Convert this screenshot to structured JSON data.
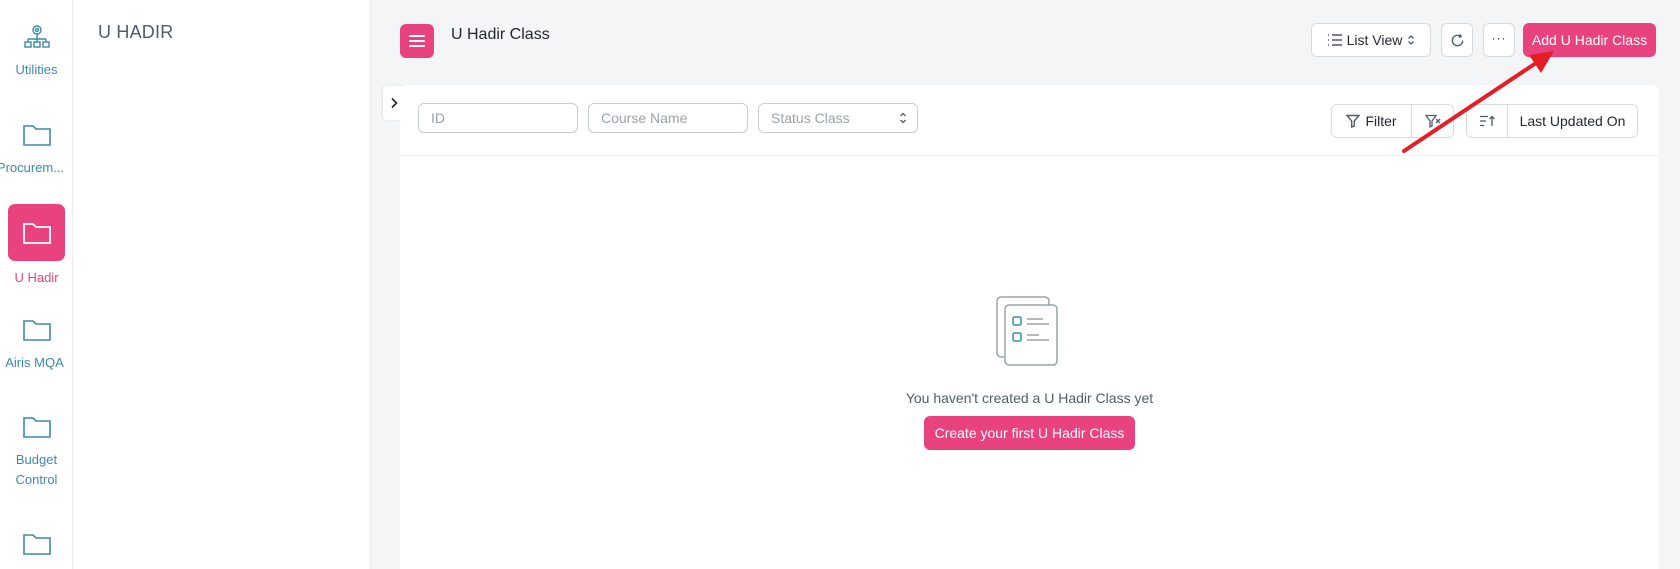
{
  "rail": {
    "items": [
      {
        "label": "Utilities",
        "icon": "org-chart-icon"
      },
      {
        "label": "Procurem...",
        "icon": "folder-icon"
      },
      {
        "label": "U Hadir",
        "icon": "folder-icon",
        "active": true
      },
      {
        "label": "Airis MQA",
        "icon": "folder-icon"
      },
      {
        "label": "Budget Control",
        "icon": "folder-icon"
      },
      {
        "label": "",
        "icon": "folder-icon"
      }
    ]
  },
  "workspace": {
    "title": "U HADIR"
  },
  "header": {
    "title": "U Hadir Class",
    "view_select": "List View",
    "add_button": "Add U Hadir Class",
    "more_label": "···"
  },
  "filters": {
    "id_placeholder": "ID",
    "course_placeholder": "Course Name",
    "status_placeholder": "Status Class",
    "filter_label": "Filter",
    "sort_label": "Last Updated On"
  },
  "empty_state": {
    "message": "You haven't created a U Hadir Class yet",
    "create_button": "Create your first U Hadir Class"
  },
  "colors": {
    "accent": "#e8437f",
    "rail_text": "#3b8aa8",
    "annotation_arrow": "#e31e24"
  }
}
